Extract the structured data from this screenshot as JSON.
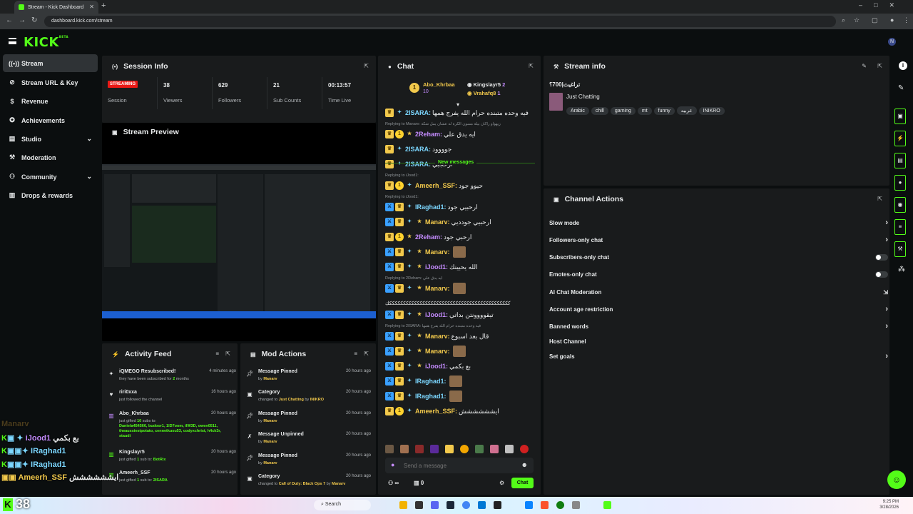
{
  "browser": {
    "tab_title": "Stream - Kick Dashboard",
    "url": "dashboard.kick.com/stream"
  },
  "logo": "KICK",
  "logo_sup": "BETA",
  "sidebar": {
    "items": [
      {
        "label": "Stream",
        "icon": "broadcast-icon"
      },
      {
        "label": "Stream URL & Key",
        "icon": "link-icon"
      },
      {
        "label": "Revenue",
        "icon": "dollar-icon"
      },
      {
        "label": "Achievements",
        "icon": "badge-icon"
      },
      {
        "label": "Studio",
        "icon": "layout-icon"
      },
      {
        "label": "Moderation",
        "icon": "wrench-icon"
      },
      {
        "label": "Community",
        "icon": "people-icon"
      },
      {
        "label": "Drops & rewards",
        "icon": "gift-icon"
      }
    ]
  },
  "session": {
    "title": "Session Info",
    "status_badge": "STREAMING",
    "status_label": "Session",
    "viewers": "38",
    "viewers_label": "Viewers",
    "followers": "629",
    "followers_label": "Followers",
    "subs": "21",
    "subs_label": "Sub Counts",
    "time_live": "00:13:57",
    "time_label": "Time Live"
  },
  "preview": {
    "title": "Stream Preview"
  },
  "activity": {
    "title": "Activity Feed",
    "items": [
      {
        "t": "iQMEGO Resubscribed!",
        "s1": "they have been subscribed for ",
        "hl": "2",
        "s2": " months",
        "tm": "4 minutes ago",
        "icon": "star-icon"
      },
      {
        "t": "riri0xxa",
        "s1": "just followed the channel",
        "hl": "",
        "s2": "",
        "tm": "16 hours ago",
        "icon": "heart-icon"
      },
      {
        "t": "Abo_Khrbaa",
        "s1": "just gifted ",
        "hl": "10",
        "s2": " subs to:",
        "tm": "20 hours ago",
        "icon": "gift-icon",
        "extra": "Daniela454566, budoor1, 1lD7oom, ilW3D, owen0511, theaussiestpotato, cennetkusu53, codyxchrist, h4ck3r, staudi"
      },
      {
        "t": "Kingslayr5",
        "s1": "just gifted ",
        "hl": "1",
        "s2": " sub to: ",
        "hl2": "BotRix",
        "tm": "20 hours ago",
        "icon": "gift-icon"
      },
      {
        "t": "Ameerh_SSF",
        "s1": "just gifted ",
        "hl": "1",
        "s2": " sub to: ",
        "hl2": "2ISARA",
        "tm": "20 hours ago",
        "icon": "gift-icon"
      }
    ]
  },
  "mod": {
    "title": "Mod Actions",
    "items": [
      {
        "t": "Message Pinned",
        "s": "by ",
        "who": "Manarv",
        "tm": "20 hours ago",
        "icon": "pin-icon"
      },
      {
        "t": "Category",
        "s": "changed to ",
        "cat": "Just Chatting",
        "by": " by ",
        "who": "INIKRO",
        "tm": "20 hours ago",
        "icon": "category-icon"
      },
      {
        "t": "Message Pinned",
        "s": "by ",
        "who": "Manarv",
        "tm": "20 hours ago",
        "icon": "pin-icon"
      },
      {
        "t": "Message Unpinned",
        "s": "by ",
        "who": "Manarv",
        "tm": "20 hours ago",
        "icon": "unpin-icon"
      },
      {
        "t": "Message Pinned",
        "s": "by ",
        "who": "Manarv",
        "tm": "20 hours ago",
        "icon": "pin-icon"
      },
      {
        "t": "Category",
        "s": "changed to ",
        "cat": "Call of Duty: Black Ops 7",
        "by": " by ",
        "who": "Manarv",
        "tm": "20 hours ago",
        "icon": "category-icon"
      }
    ]
  },
  "chat": {
    "title": "Chat",
    "top": [
      {
        "name": "Abo_Khrbaa",
        "count": "10",
        "rank": "1"
      },
      {
        "name": "Kingslayr5",
        "count": "2"
      },
      {
        "name": "Vrahafq8",
        "count": "1"
      }
    ],
    "new_messages": "New messages",
    "placeholder": "Send a message",
    "viewers_count": "∞",
    "points": "0",
    "send": "Chat",
    "messages": [
      {
        "badges": [
          "crown",
          "vip"
        ],
        "name": "2ISARA:",
        "color": "#7cd7ff",
        "text": "فيه وحده متبنده حرام الله يفرج همها"
      },
      {
        "reply": "Replying to Manarv: زيهواو راكان بيلة مسون الكرة له عشان يمل شكة"
      },
      {
        "badges": [
          "crown",
          "sub",
          "star"
        ],
        "name": "2Reham:",
        "color": "#c58cff",
        "text": "ايه يدق علي"
      },
      {
        "badges": [
          "crown",
          "vip"
        ],
        "name": "2ISARA:",
        "color": "#7cd7ff",
        "text": "جوووود"
      },
      {
        "badges": [
          "crown",
          "vip"
        ],
        "name": "2ISARA:",
        "color": "#7cd7ff",
        "text": "ارحجبي"
      },
      {
        "reply": "Replying to iJood1:"
      },
      {
        "badges": [
          "crown",
          "sub",
          "vip"
        ],
        "name": "Ameerh_SSF:",
        "color": "#f2c94c",
        "text": "حيوو جود"
      },
      {
        "reply": "Replying to iJood1:"
      },
      {
        "badges": [
          "mod",
          "crown",
          "vip"
        ],
        "name": "IRaghad1:",
        "color": "#7cd7ff",
        "text": "ارحبيي جود"
      },
      {
        "badges": [
          "mod",
          "crown",
          "vip",
          "star"
        ],
        "name": "Manarv:",
        "color": "#f2c94c",
        "text": "ارحبيي جودديي"
      },
      {
        "badges": [
          "crown",
          "sub",
          "star"
        ],
        "name": "2Reham:",
        "color": "#c58cff",
        "text": "ارحبي جود"
      },
      {
        "badges": [
          "mod",
          "crown",
          "vip",
          "star"
        ],
        "name": "Manarv:",
        "color": "#f2c94c",
        "text": ""
      },
      {
        "badges": [
          "mod",
          "crown",
          "vip",
          "star"
        ],
        "name": "iJood1:",
        "color": "#c58cff",
        "text": "الله يحيينك"
      },
      {
        "reply": "Replying to 2Reham: ايه يدق علي"
      },
      {
        "badges": [
          "mod",
          "crown",
          "vip",
          "star"
        ],
        "name": "Manarv:",
        "color": "#f2c94c",
        "text": ""
      },
      {
        "long": "ككككككككككككككككككككككككككككككككككككككككككككك"
      },
      {
        "badges": [
          "mod",
          "crown",
          "vip",
          "star"
        ],
        "name": "iJood1:",
        "color": "#c58cff",
        "text": "تيقوووونتن بداتي"
      },
      {
        "reply": "Replying to 2ISARA: فيه وحده متبنده حرام الله يفرج همها"
      },
      {
        "badges": [
          "mod",
          "crown",
          "vip",
          "star"
        ],
        "name": "Manarv:",
        "color": "#f2c94c",
        "text": "قال بعد اسبوع"
      },
      {
        "badges": [
          "mod",
          "crown",
          "vip",
          "star"
        ],
        "name": "Manarv:",
        "color": "#f2c94c",
        "text": ""
      },
      {
        "badges": [
          "mod",
          "crown",
          "vip",
          "star"
        ],
        "name": "iJood1:",
        "color": "#c58cff",
        "text": "بع بكمي"
      },
      {
        "badges": [
          "mod",
          "crown",
          "vip"
        ],
        "name": "IRaghad1:",
        "color": "#7cd7ff",
        "text": ""
      },
      {
        "badges": [
          "mod",
          "crown",
          "vip"
        ],
        "name": "IRaghad1:",
        "color": "#7cd7ff",
        "text": ""
      },
      {
        "badges": [
          "crown",
          "sub",
          "vip"
        ],
        "name": "Ameerh_SSF:",
        "color": "#f2c94c",
        "text": "ايشششششش"
      }
    ]
  },
  "stream_info": {
    "title": "Stream info",
    "stream_title": "تراغيث|700؟",
    "category": "Just Chatting",
    "tags": [
      "Arabic",
      "chill",
      "gaming",
      "mt",
      "funny",
      "عربيه",
      "INIKRO"
    ]
  },
  "channel_actions": {
    "title": "Channel Actions",
    "items": [
      {
        "label": "Slow mode",
        "control": "chevron"
      },
      {
        "label": "Followers-only chat",
        "control": "chevron"
      },
      {
        "label": "Subscribers-only chat",
        "control": "toggle"
      },
      {
        "label": "Emotes-only chat",
        "control": "toggle"
      },
      {
        "label": "AI Chat Moderation",
        "control": "external"
      },
      {
        "label": "Account age restriction",
        "control": "chevron"
      },
      {
        "label": "Banned words",
        "control": "chevron"
      },
      {
        "label": "Host Channel",
        "control": "none"
      },
      {
        "label": "Set goals",
        "control": "chevron"
      }
    ]
  },
  "overlay": [
    {
      "name": "Manarv",
      "text": ""
    },
    {
      "name": "iJood1",
      "text": "بع بكمي"
    },
    {
      "name": "IRaghad1",
      "text": ""
    },
    {
      "name": "IRaghad1",
      "text": ""
    },
    {
      "name": "Ameerh_SSF",
      "text": "ايشششششش"
    }
  ],
  "overlay_count": "38",
  "taskbar": {
    "search": "Search",
    "time": "9:25 PM",
    "date": "3/28/2026"
  },
  "colors": {
    "accent": "#53fc18",
    "panel": "#191b1c",
    "bg": "#0b0e0f"
  }
}
